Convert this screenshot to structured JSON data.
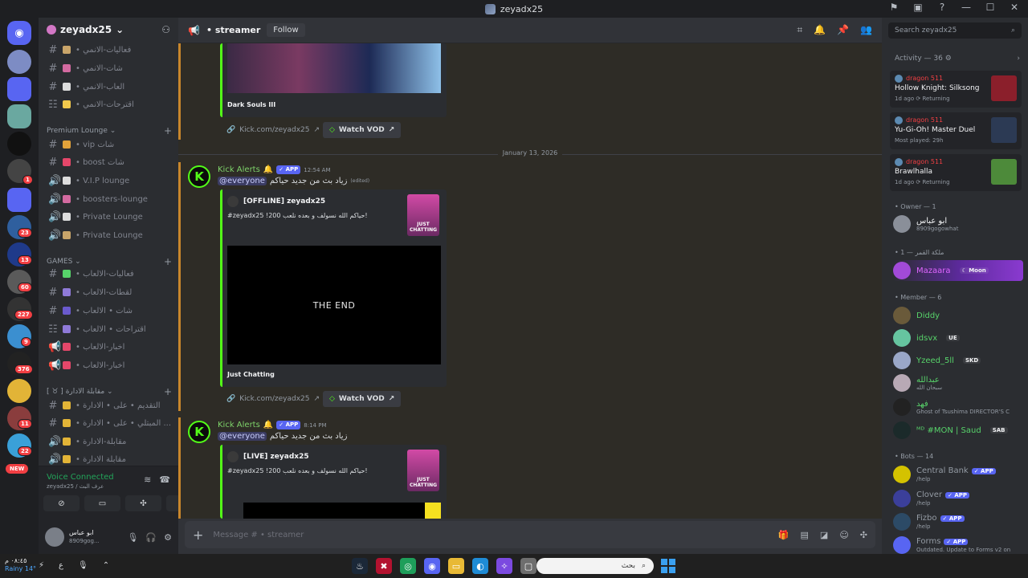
{
  "window": {
    "title": "zeyadx25",
    "controls": [
      "⚑",
      "▣",
      "?",
      "—",
      "☐",
      "✕"
    ]
  },
  "rail": {
    "badges": [
      "1",
      "23",
      "13",
      "60",
      "227",
      "9",
      "376",
      "11",
      "22"
    ],
    "new_label": "NEW"
  },
  "sidebar": {
    "server_name": "zeyadx25",
    "channels_top": [
      {
        "label": "• فعاليات-الانمي"
      },
      {
        "label": "• شات-الانمي"
      },
      {
        "label": "• العاب-الانمي"
      },
      {
        "label": "• اقترحات-الانمي"
      }
    ],
    "cat_premium": "Premium Lounge",
    "premium": [
      {
        "label": "• vip شات"
      },
      {
        "label": "• boost شات"
      },
      {
        "label": "• V.I.P lounge"
      },
      {
        "label": "• boosters-lounge"
      },
      {
        "label": "• Private Lounge"
      },
      {
        "label": "• Private Lounge"
      }
    ],
    "cat_games": "GAMES",
    "games": [
      {
        "label": "• فعاليات-الالعاب"
      },
      {
        "label": "• لقطات-الالعاب"
      },
      {
        "label": "• شات • الالعاب"
      },
      {
        "label": "• اقتراحات • الالعاب"
      },
      {
        "label": "• اخبار-الالعاب"
      },
      {
        "label": "• اخبار-الالعاب"
      }
    ],
    "cat_admin": "[ ♉ ] مقابلة الادارة",
    "admin": [
      {
        "label": "• التقديم • على • الادارة"
      },
      {
        "label": "• المبتلي • على • الادارة ..."
      },
      {
        "label": "• مقابلة-الادارة"
      },
      {
        "label": "• مقابلة الادارة"
      }
    ],
    "voice": {
      "status": "Voice Connected",
      "sub": "zeyadx25 / عرف البث"
    },
    "user": {
      "name": "ابو عباس",
      "status": "8909gog..."
    }
  },
  "main": {
    "channel": "streamer",
    "follow": "Follow",
    "first_embed": {
      "footer": "Dark Souls III",
      "link": "Kick.com/zeyadx25",
      "vod": "Watch VOD"
    },
    "date": "January 13, 2026",
    "msg1": {
      "author": "Kick Alerts",
      "app": "APP",
      "time": "12:54 AM",
      "mention": "@everyone",
      "text": "زياد بث من جديد حياكم",
      "edited": "(edited)",
      "embed_title": "[OFFLINE] zeyadx25",
      "embed_desc": "#zeyadx25 !200 حياكم الله نسولف و بعده نلعب!",
      "thumb": "JUST CHATTING",
      "image_text": "THE END",
      "footer": "Just Chatting",
      "link": "Kick.com/zeyadx25",
      "vod": "Watch VOD"
    },
    "msg2": {
      "author": "Kick Alerts",
      "app": "APP",
      "time": "8:14 PM",
      "mention": "@everyone",
      "text": "زياد بث من جديد حياكم",
      "embed_title": "[LIVE] zeyadx25",
      "embed_desc": "#zeyadx25 !200 حياكم الله نسولف و بعده نلعب!",
      "thumb": "JUST CHATTING"
    },
    "composer_placeholder": "Message #  •  streamer"
  },
  "members": {
    "search_placeholder": "Search zeyadx25",
    "activity_header": "Activity — 36",
    "activities": [
      {
        "name": "dragon 511",
        "game": "Hollow Knight: Silksong",
        "detail": "1d ago  ⟳ Returning",
        "color": "#8b1f2b"
      },
      {
        "name": "dragon 511",
        "game": "Yu-Gi-Oh! Master Duel",
        "detail": "Most played: 29h",
        "color": "#2c3a54"
      },
      {
        "name": "dragon 511",
        "game": "Brawlhalla",
        "detail": "1d ago  ⟳ Returning",
        "color": "#4d8a3a"
      }
    ],
    "owner_header": "• Owner — 1",
    "owner": {
      "name": "ابو عباس",
      "sub": "8909gogowhat"
    },
    "queen_header": "• ملكة القمر — 1",
    "queen": {
      "name": "Mazaara",
      "tag": "Moon"
    },
    "member_header": "• Member — 6",
    "member_list": [
      {
        "name": "Diddy",
        "sub": "",
        "tag": "",
        "color": "#57d36a"
      },
      {
        "name": "idsvx",
        "sub": "",
        "tag": "UE",
        "color": "#57d36a"
      },
      {
        "name": "Yzeed_5ll",
        "sub": "",
        "tag": "SKD",
        "color": "#57d36a"
      },
      {
        "name": "عبدالله",
        "sub": "سبحان الله",
        "tag": "",
        "color": "#57d36a"
      },
      {
        "name": "فهد",
        "sub": "Ghost of Tsushima DIRECTOR'S C",
        "tag": "",
        "color": "#57d36a"
      },
      {
        "name": "ᴹᴰ #MON | Saud",
        "sub": "",
        "tag": "SAB",
        "color": "#57d36a"
      }
    ],
    "bots_header": "• Bots — 14",
    "bots": [
      {
        "name": "Central Bank",
        "sub": "/help"
      },
      {
        "name": "Clover",
        "sub": "/help"
      },
      {
        "name": "Fizbo",
        "sub": "/help"
      },
      {
        "name": "Forms",
        "sub": "Outdated. Update to Forms v2 on"
      }
    ],
    "app_tag": "APP"
  },
  "taskbar": {
    "time": "٠٨:٤٥ م",
    "date": "Rainy 14°",
    "search": "بحث",
    "lang": "ع"
  }
}
